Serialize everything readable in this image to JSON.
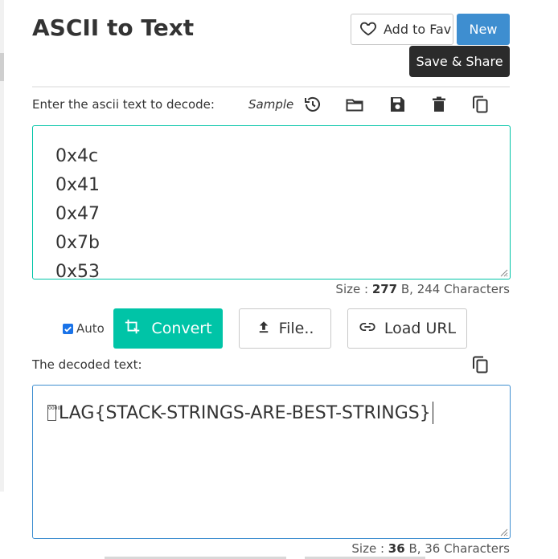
{
  "header": {
    "title": "ASCII to Text",
    "fav_label": "Add to Fav",
    "new_label": "New",
    "tooltip": "Save & Share"
  },
  "input": {
    "label": "Enter the ascii text to decode:",
    "sample_label": "Sample",
    "lines": [
      "0x4c",
      "0x41",
      "0x47",
      "0x7b",
      "0x53"
    ],
    "size_prefix": "Size : ",
    "size_bytes": "277",
    "size_suffix": " B, 244 Characters"
  },
  "toolbar_icons": [
    "history-icon",
    "folder-open-icon",
    "save-icon",
    "delete-icon",
    "copy-icon"
  ],
  "controls": {
    "auto_label": "Auto",
    "auto_checked": true,
    "convert_label": "Convert",
    "file_label": "File..",
    "load_url_label": "Load URL"
  },
  "output": {
    "label": "The decoded text:",
    "control_char": "0000",
    "text": "LAG{STACK-STRINGS-ARE-BEST-STRINGS}",
    "size_prefix": "Size : ",
    "size_bytes": "36",
    "size_suffix": " B, 36 Characters"
  },
  "colors": {
    "primary_teal": "#00c4a7",
    "info_blue": "#3e8ed0",
    "tooltip_dark": "#2b2b2b"
  }
}
